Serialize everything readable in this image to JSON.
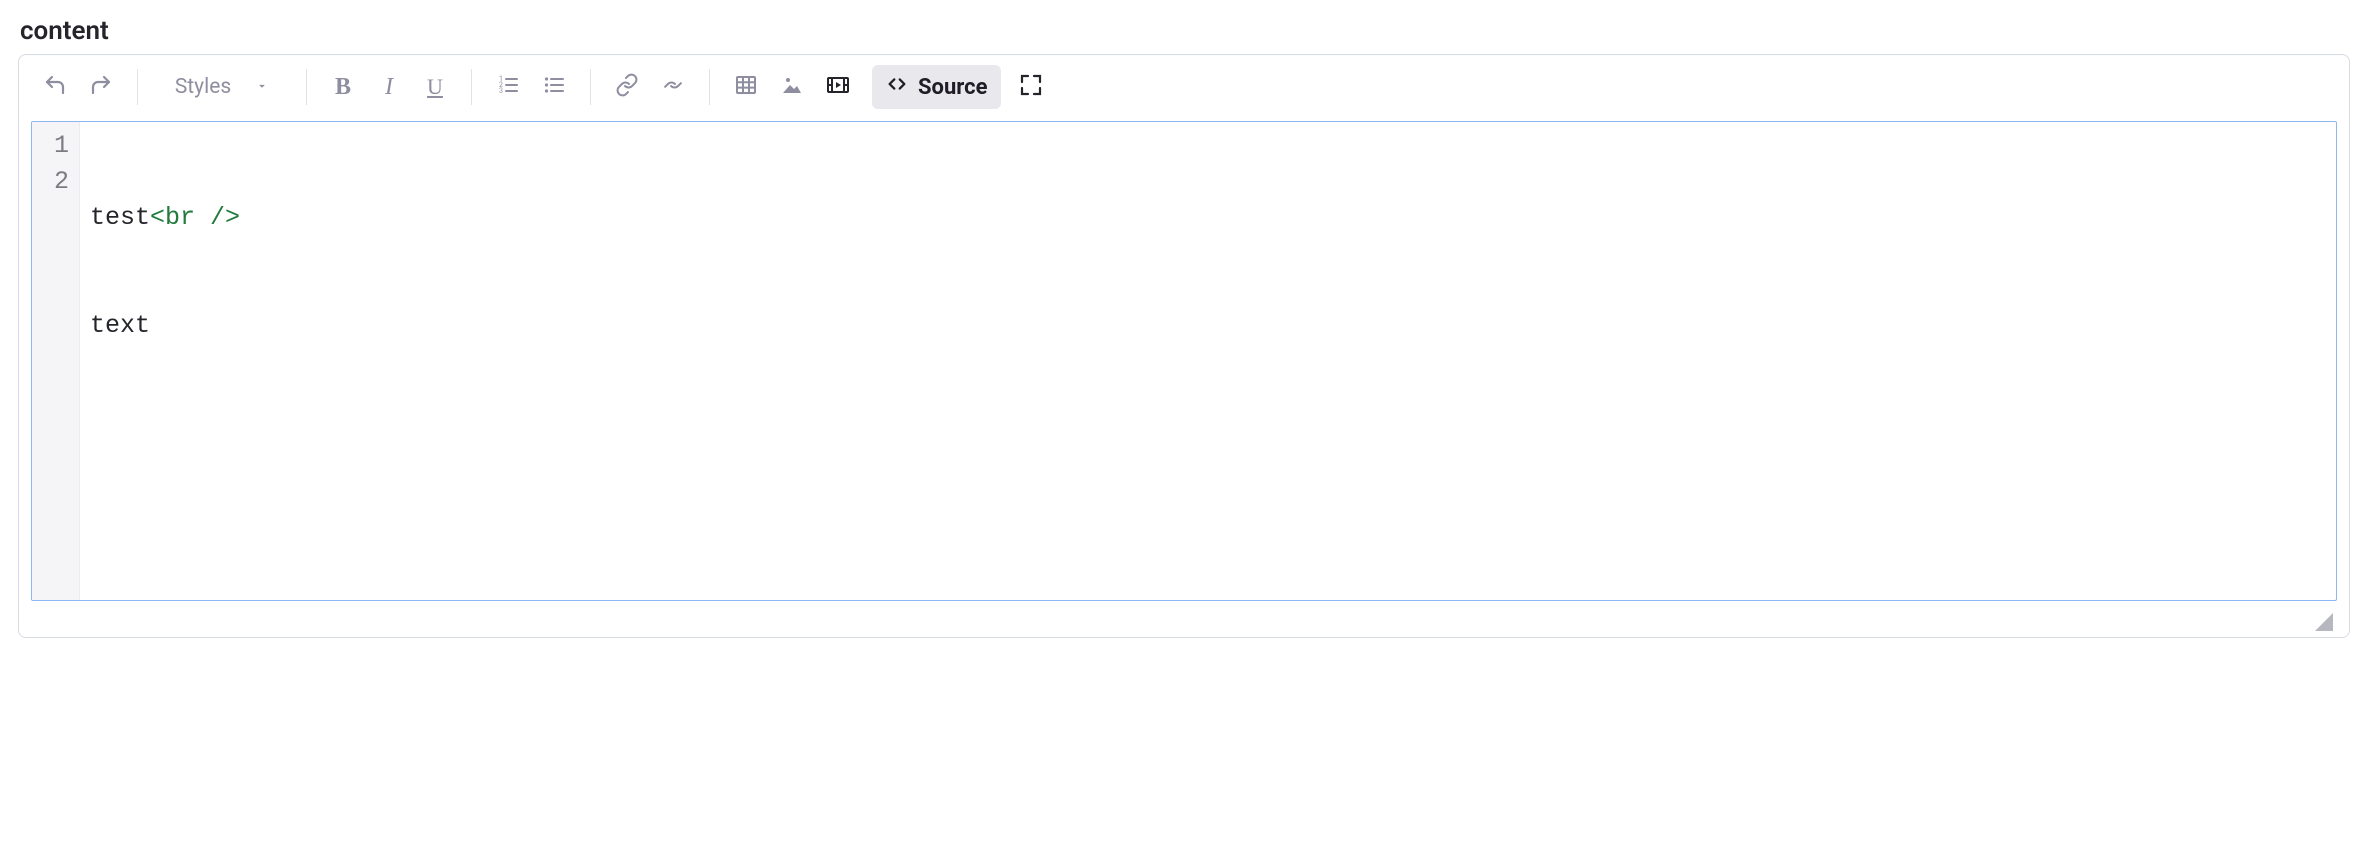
{
  "field": {
    "label": "content"
  },
  "toolbar": {
    "styles_label": "Styles",
    "source_label": "Source"
  },
  "code": {
    "lines": [
      {
        "no": "1",
        "plain": "test",
        "tag": "<br />"
      },
      {
        "no": "2",
        "plain": "text",
        "tag": ""
      }
    ]
  }
}
